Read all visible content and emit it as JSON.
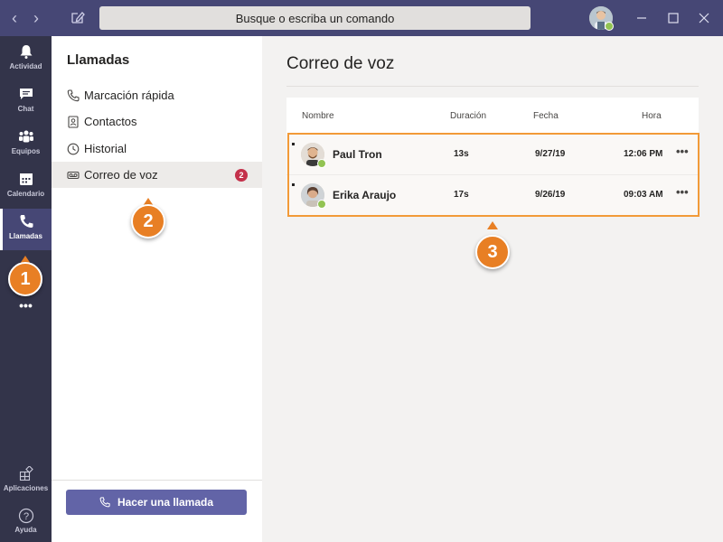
{
  "titlebar": {
    "search_placeholder": "Busque o escriba un comando"
  },
  "appbar": {
    "items": [
      {
        "label": "Actividad",
        "icon": "bell-icon"
      },
      {
        "label": "Chat",
        "icon": "chat-icon"
      },
      {
        "label": "Equipos",
        "icon": "teams-icon"
      },
      {
        "label": "Calendario",
        "icon": "calendar-icon"
      },
      {
        "label": "Llamadas",
        "icon": "phone-icon",
        "active": true
      }
    ],
    "more": "•••",
    "apps_label": "Aplicaciones",
    "help_label": "Ayuda"
  },
  "sidebar": {
    "title": "Llamadas",
    "items": [
      {
        "label": "Marcación rápida",
        "icon": "phone-icon"
      },
      {
        "label": "Contactos",
        "icon": "contacts-icon"
      },
      {
        "label": "Historial",
        "icon": "clock-icon"
      },
      {
        "label": "Correo de voz",
        "icon": "voicemail-icon",
        "badge": "2",
        "active": true
      }
    ],
    "call_button": "Hacer una llamada"
  },
  "main": {
    "title": "Correo de voz",
    "columns": [
      "Nombre",
      "Duración",
      "Fecha",
      "Hora"
    ],
    "rows": [
      {
        "name": "Paul Tron",
        "duration": "13s",
        "date": "9/27/19",
        "time": "12:06 PM",
        "more": "•••"
      },
      {
        "name": "Erika Araujo",
        "duration": "17s",
        "date": "9/26/19",
        "time": "09:03 AM",
        "more": "•••"
      }
    ]
  },
  "callouts": [
    "1",
    "2",
    "3"
  ],
  "colors": {
    "titlebar": "#464775",
    "appbar": "#33344a",
    "accent": "#6264a7",
    "badge": "#c4314b",
    "callout": "#e87f24",
    "presence": "#92c353"
  }
}
